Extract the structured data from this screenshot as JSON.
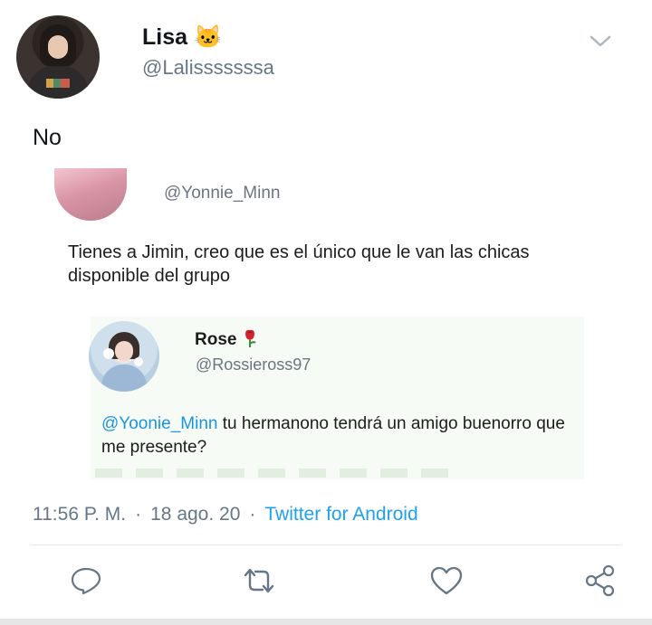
{
  "tweet": {
    "author_name": "Lisa 🐱",
    "author_handle": "@Lalisssssssa",
    "text": "No",
    "time": "11:56 P. M.",
    "date": "18 ago. 20",
    "source": "Twitter for Android"
  },
  "embedded": {
    "first_handle": "@Yonnie_Minn",
    "first_text": "Tienes a Jimin, creo que es el único que le van las chicas disponible del grupo",
    "quote": {
      "name": "Rose",
      "handle": "@Rossieross97",
      "mention": "@Yoonie_Minn",
      "text": " tu hermanono tendrá un amigo buenorro que me presente?"
    }
  },
  "meta_separator": "·",
  "icons": {
    "menu": "chevron-down-icon",
    "reply": "reply-icon",
    "retweet": "retweet-icon",
    "like": "heart-icon",
    "share": "share-icon",
    "rose_emoji": "rose-icon"
  },
  "colors": {
    "link": "#1da1f2",
    "secondary_text": "#657786",
    "divider": "#e1e8ed"
  }
}
